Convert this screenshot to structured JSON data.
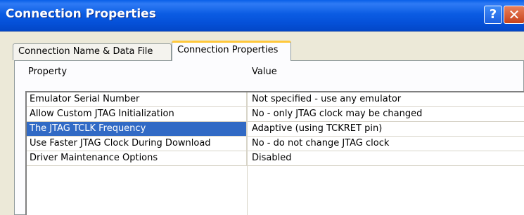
{
  "window": {
    "title": "Connection Properties",
    "help_glyph": "?",
    "close_glyph": "✕"
  },
  "tabs": [
    {
      "label": "Connection Name & Data File",
      "active": false
    },
    {
      "label": "Connection Properties",
      "active": true
    }
  ],
  "grid": {
    "headers": {
      "property": "Property",
      "value": "Value"
    },
    "rows": [
      {
        "property": "Emulator Serial Number",
        "value": "Not specified - use any emulator"
      },
      {
        "property": "Allow Custom JTAG Initialization",
        "value": "No - only JTAG clock may be changed"
      },
      {
        "property": "The JTAG TCLK Frequency",
        "value": "Adaptive (using TCKRET pin)",
        "selected": true
      },
      {
        "property": "Use Faster JTAG Clock During Download",
        "value": "No - do not change JTAG clock"
      },
      {
        "property": "Driver Maintenance Options",
        "value": "Disabled"
      }
    ]
  },
  "colors": {
    "titlebar": "#0550d8",
    "selection": "#316ac5",
    "active_tab_accent": "#ffc83c"
  },
  "icons": {
    "help": "help-icon",
    "close": "close-icon",
    "dropdown": "chevron-down-icon"
  }
}
